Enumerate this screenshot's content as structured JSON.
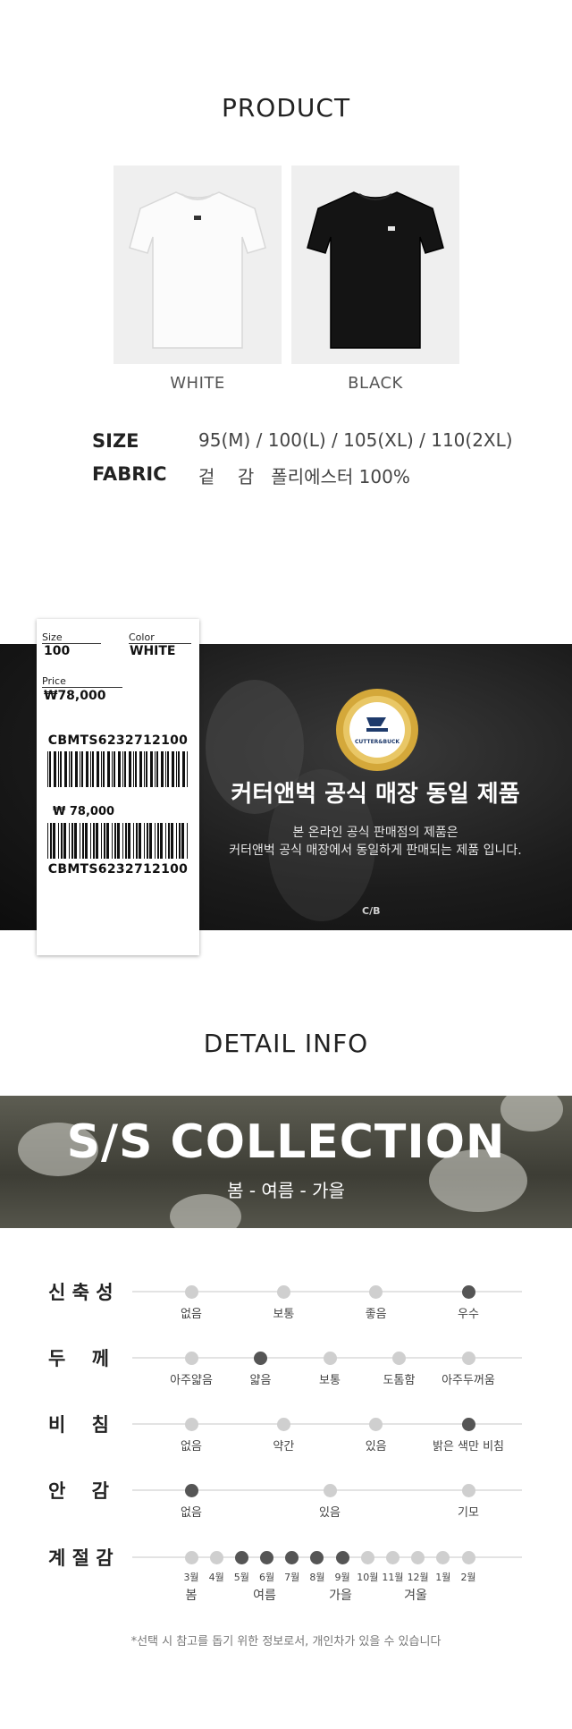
{
  "product": {
    "title": "PRODUCT",
    "variants": [
      {
        "label": "WHITE",
        "color": "#ffffff"
      },
      {
        "label": "BLACK",
        "color": "#151515"
      }
    ],
    "specs": [
      {
        "key": "SIZE",
        "value": "95(M) / 100(L) / 105(XL) / 110(2XL)"
      },
      {
        "key": "FABRIC",
        "value": "겉    감   폴리에스터 100%"
      }
    ]
  },
  "tag": {
    "size_label": "Size",
    "size_value": "100",
    "color_label": "Color",
    "color_value": "WHITE",
    "price_label": "Price",
    "price_value": "₩78,000",
    "code": "CBMTS6232712100",
    "price_value_2": "₩ 78,000",
    "code_2": "CBMTS6232712100"
  },
  "banner": {
    "badge_text": "CUTTER&BUCK",
    "headline": "커터앤벅 공식 매장 동일 제품",
    "sub_line_1": "본 온라인 공식 판매점의 제품은",
    "sub_line_2": "커터앤벅 공식 매장에서 동일하게 판매되는 제품 입니다."
  },
  "detail": {
    "title": "DETAIL INFO",
    "collection_title": "S/S COLLECTION",
    "collection_sub": "봄 - 여름 - 가을"
  },
  "ratings": [
    {
      "label": "신 축 성",
      "options": [
        "없음",
        "보통",
        "좋음",
        "우수"
      ],
      "selected": 3
    },
    {
      "label": "두    께",
      "options": [
        "아주얇음",
        "얇음",
        "보통",
        "도톰함",
        "아주두꺼움"
      ],
      "selected": 1
    },
    {
      "label": "비    침",
      "options": [
        "없음",
        "약간",
        "있음",
        "밝은 색만 비침"
      ],
      "selected": 3
    },
    {
      "label": "안    감",
      "options": [
        "없음",
        "있음",
        "기모"
      ],
      "selected": 0
    }
  ],
  "season": {
    "label": "계 절 감",
    "months": [
      "3월",
      "4월",
      "5월",
      "6월",
      "7월",
      "8월",
      "9월",
      "10월",
      "11월",
      "12월",
      "1월",
      "2월"
    ],
    "active": [
      2,
      3,
      4,
      5,
      6
    ],
    "seasons": [
      "봄",
      "여름",
      "가을",
      "겨울"
    ]
  },
  "note": "*선택 시 참고를 돕기 위한 정보로서, 개인차가 있을 수 있습니다",
  "colors": {
    "dot_on": "#555555",
    "dot_off": "#cfcfcf",
    "badge_gold": "#d4a83a"
  }
}
